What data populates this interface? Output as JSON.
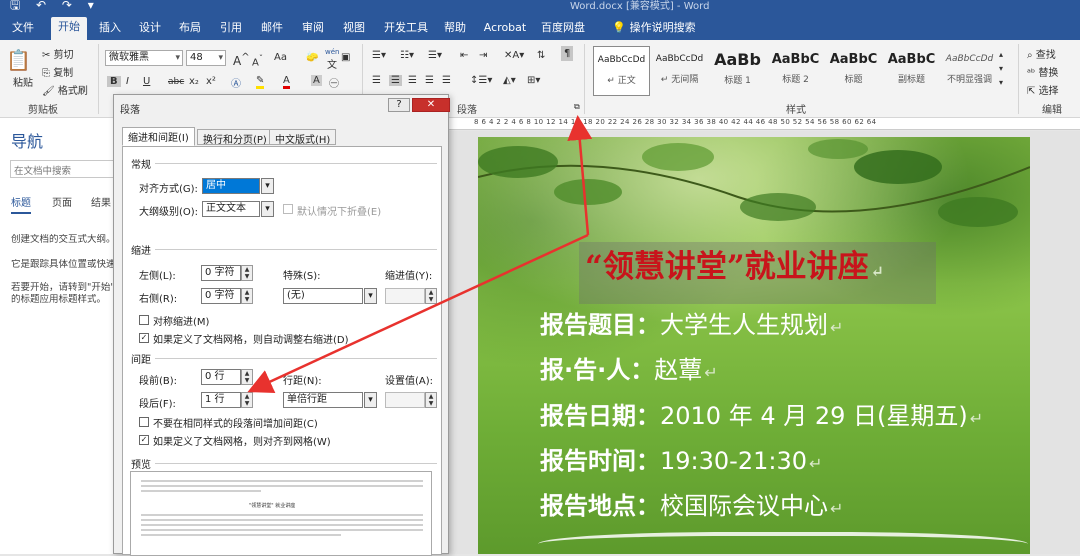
{
  "window": {
    "title": "Word.docx [兼容模式] - Word"
  },
  "tabs": [
    "文件",
    "开始",
    "插入",
    "设计",
    "布局",
    "引用",
    "邮件",
    "审阅",
    "视图",
    "开发工具",
    "帮助",
    "Acrobat",
    "百度网盘"
  ],
  "tell_me": "操作说明搜索",
  "ribbon": {
    "clipboard": {
      "paste": "粘贴",
      "cut": "剪切",
      "copy": "复制",
      "format_painter": "格式刷",
      "group": "剪贴板"
    },
    "font": {
      "name": "微软雅黑",
      "size": "48",
      "group": "字体",
      "letters": {
        "aa": "Aa",
        "bold": "B",
        "italic": "I",
        "underline": "U",
        "strike": "abc",
        "sub": "x₂",
        "sup": "x²",
        "wen": "wén",
        "wen_char": "文",
        "grow": "A",
        "shrink": "A",
        "font_color": "A",
        "highlight": "A"
      }
    },
    "paragraph": {
      "group": "段落"
    },
    "styles": {
      "group": "样式",
      "items": [
        {
          "preview": "AaBbCcDd",
          "name": "↵ 正文"
        },
        {
          "preview": "AaBbCcDd",
          "name": "↵ 无间隔"
        },
        {
          "preview": "AaBb",
          "name": "标题 1"
        },
        {
          "preview": "AaBbC",
          "name": "标题 2"
        },
        {
          "preview": "AaBbC",
          "name": "标题"
        },
        {
          "preview": "AaBbC",
          "name": "副标题"
        },
        {
          "preview": "AaBbCcDd",
          "name": "不明显强调"
        }
      ]
    },
    "editing": {
      "find": "查找",
      "replace": "替换",
      "select": "选择",
      "group": "编辑"
    }
  },
  "nav": {
    "title": "导航",
    "search_placeholder": "在文档中搜索",
    "tabs": [
      "标题",
      "页面",
      "结果"
    ],
    "lines": [
      "创建文档的交互式大纲。",
      "它是跟踪具体位置或快速...",
      "若要开始，请转到\"开始\"...",
      "的标题应用标题样式。"
    ]
  },
  "ruler": "8  6  4  2     2  4  6  8  10  12  14  16  18  20  22  24  26  28  30  32  34  36  38  40  42  44  46  48  50  52  54  56  58  60  62  64",
  "dialog": {
    "title": "段落",
    "help": "?",
    "close": "✕",
    "tabs": [
      "缩进和间距(I)",
      "换行和分页(P)",
      "中文版式(H)"
    ],
    "general": {
      "section": "常规",
      "align_label": "对齐方式(G):",
      "align_value": "居中",
      "outline_label": "大纲级别(O):",
      "outline_value": "正文文本",
      "collapse_label": "默认情况下折叠(E)"
    },
    "indent": {
      "section": "缩进",
      "left_label": "左侧(L):",
      "left_value": "0 字符",
      "right_label": "右侧(R):",
      "right_value": "0 字符",
      "special_label": "特殊(S):",
      "special_value": "(无)",
      "indent_value_label": "缩进值(Y):",
      "mirror_label": "对称缩进(M)",
      "grid_label": "如果定义了文档网格，则自动调整右缩进(D)"
    },
    "spacing": {
      "section": "间距",
      "before_label": "段前(B):",
      "before_value": "0 行",
      "after_label": "段后(F):",
      "after_value": "1 行",
      "line_label": "行距(N):",
      "line_value": "单倍行距",
      "setting_label": "设置值(A):",
      "no_space_label": "不要在相同样式的段落间增加间距(C)",
      "snap_label": "如果定义了文档网格，则对齐到网格(W)"
    },
    "preview_section": "预览",
    "preview_title": "\"领慧讲堂\" 就业讲座"
  },
  "document": {
    "title": "“领慧讲堂”就业讲座",
    "lines": [
      {
        "key": "报告题目：",
        "value": "大学生人生规划"
      },
      {
        "key": "报·告·人：",
        "value": "赵蕈"
      },
      {
        "key": "报告日期：",
        "value": "2010 年 4 月 29 日(星期五)"
      },
      {
        "key": "报告时间：",
        "value": "19:30-21:30"
      },
      {
        "key": "报告地点：",
        "value": "校国际会议中心"
      }
    ],
    "paragraph_mark": "↵"
  },
  "colors": {
    "accent": "#2b579a",
    "title_red": "#c8141b",
    "arrow": "#e8322e"
  }
}
